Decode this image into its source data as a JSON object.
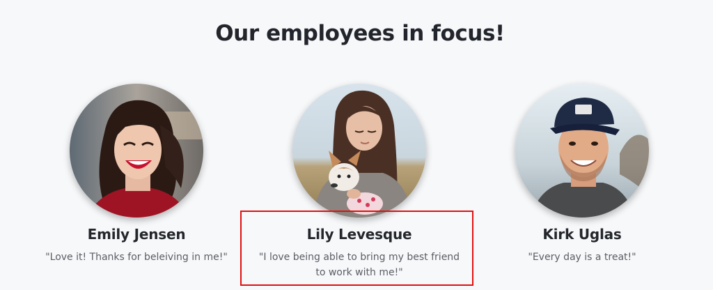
{
  "section": {
    "title": "Our employees in focus!"
  },
  "employees": [
    {
      "name": "Emily Jensen",
      "quote": "\"Love it! Thanks for beleiving in me!\"",
      "photo": "photo-woman-smiling-red-sweater"
    },
    {
      "name": "Lily Levesque",
      "quote": "\"I love being able to bring my best friend to work with me!\"",
      "photo": "photo-woman-holding-small-dog"
    },
    {
      "name": "Kirk Uglas",
      "quote": "\"Every day is a treat!\"",
      "photo": "photo-man-with-cap"
    }
  ],
  "colors": {
    "background": "#f7f8fa",
    "title": "#22252b",
    "quote_text": "#5a5d63",
    "highlight_border": "#e01010"
  }
}
